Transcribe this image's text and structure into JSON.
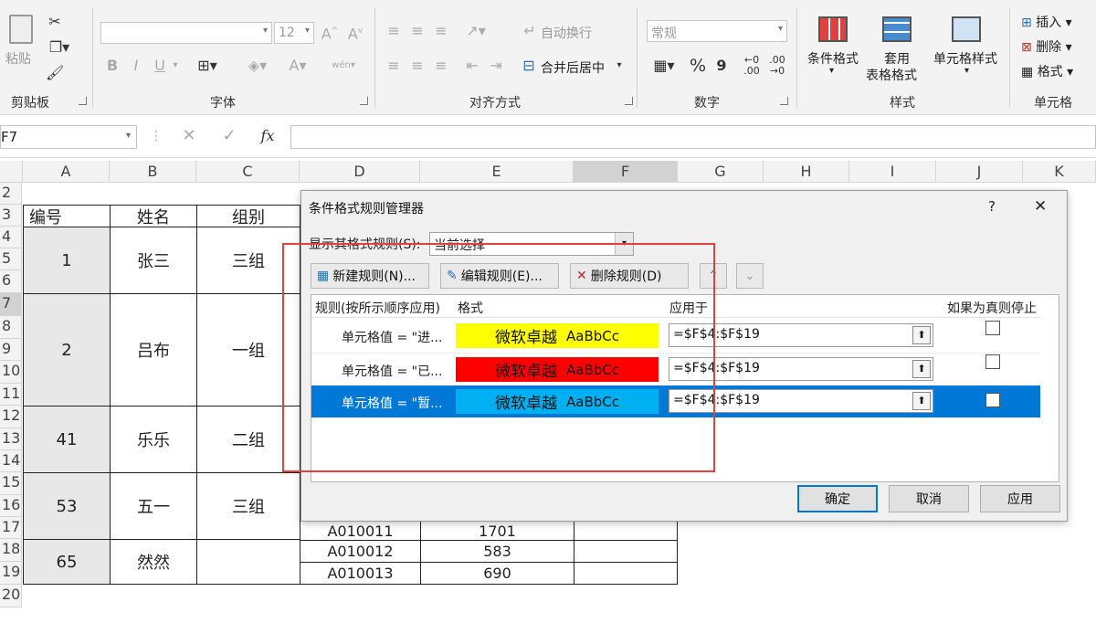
{
  "ribbon": {
    "clipboard": {
      "label": "剪贴板",
      "paste_label": "粘贴"
    },
    "font": {
      "label": "字体",
      "size_value": "12",
      "bold": "B",
      "italic": "I",
      "underline": "U",
      "phonetic": "wén"
    },
    "alignment": {
      "label": "对齐方式",
      "wrap_text": "自动换行",
      "merge_center": "合并后居中"
    },
    "number": {
      "label": "数字",
      "format_value": "常规",
      "percent": "%",
      "comma": "9"
    },
    "styles": {
      "label": "样式",
      "conditional_format": "条件格式",
      "table_format_l1": "套用",
      "table_format_l2": "表格格式",
      "cell_styles": "单元格样式"
    },
    "cells": {
      "label": "单元格",
      "insert": "插入",
      "delete": "删除",
      "format": "格式"
    }
  },
  "formula_bar": {
    "name_box": "F7",
    "fx": "fx",
    "formula": ""
  },
  "sheet": {
    "columns": [
      "A",
      "B",
      "C",
      "D",
      "E",
      "F",
      "G",
      "H",
      "I",
      "J",
      "K"
    ],
    "rows": [
      "2",
      "3",
      "4",
      "5",
      "6",
      "7",
      "8",
      "9",
      "10",
      "11",
      "12",
      "13",
      "14",
      "15",
      "16",
      "17",
      "18",
      "19",
      "20"
    ],
    "header": {
      "a": "编号",
      "b": "姓名",
      "c": "组别"
    },
    "groups": [
      {
        "id": "1",
        "name": "张三",
        "team": "三组"
      },
      {
        "id": "2",
        "name": "吕布",
        "team": "一组"
      },
      {
        "id": "41",
        "name": "乐乐",
        "team": "二组"
      },
      {
        "id": "53",
        "name": "五一",
        "team": "三组"
      },
      {
        "id": "65",
        "name": "然然",
        "team": ""
      }
    ],
    "d_rows": [
      {
        "code": "A010011",
        "value": "1701"
      },
      {
        "code": "A010012",
        "value": "583"
      },
      {
        "code": "A010013",
        "value": "690"
      }
    ]
  },
  "dialog": {
    "title": "条件格式规则管理器",
    "help": "?",
    "close": "✕",
    "show_rules_label": "显示其格式规则(S):",
    "show_rules_value": "当前选择",
    "new_rule": "新建规则(N)...",
    "edit_rule": "编辑规则(E)...",
    "delete_rule": "删除规则(D)",
    "col_rule": "规则(按所示顺序应用)",
    "col_format": "格式",
    "col_applies": "应用于",
    "col_stop": "如果为真则停止",
    "rules": [
      {
        "name": "单元格值 = \"进...",
        "preview": "微软卓越",
        "preview_sm": "AaBbCc",
        "fill": "#ffff00",
        "applies": "=$F$4:$F$19"
      },
      {
        "name": "单元格值 = \"已...",
        "preview": "微软卓越",
        "preview_sm": "AaBbCc",
        "fill": "#ff0000",
        "applies": "=$F$4:$F$19"
      },
      {
        "name": "单元格值 = \"暂...",
        "preview": "微软卓越",
        "preview_sm": "AaBbCc",
        "fill": "#00b0f0",
        "applies": "=$F$4:$F$19"
      }
    ],
    "ok": "确定",
    "cancel": "取消",
    "apply": "应用"
  },
  "colors": {
    "selection": "#0078d7",
    "highlight_box": "#e34040"
  }
}
